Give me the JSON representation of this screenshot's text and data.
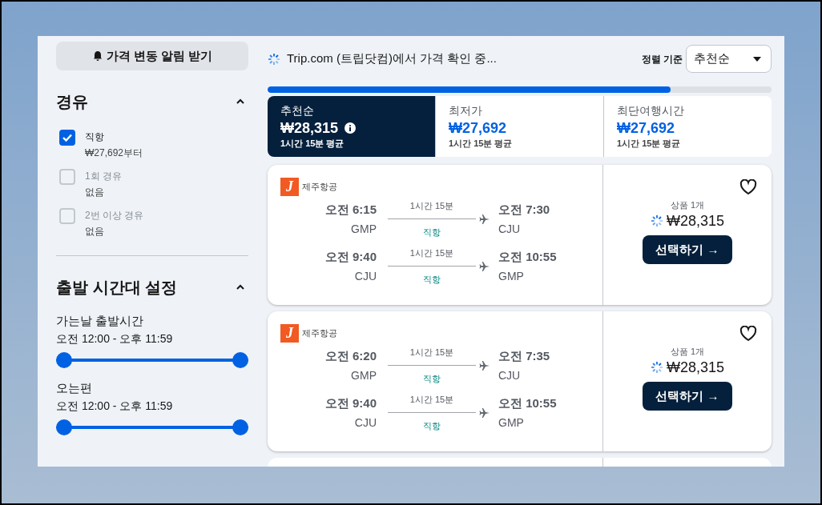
{
  "alert_button": {
    "label": "가격 변동 알림 받기"
  },
  "stops_filter": {
    "title": "경유",
    "expanded": true,
    "options": [
      {
        "label": "직항",
        "note": "₩27,692부터",
        "checked": true,
        "disabled": false
      },
      {
        "label": "1회 경유",
        "note": "없음",
        "checked": false,
        "disabled": true
      },
      {
        "label": "2번 이상 경유",
        "note": "없음",
        "checked": false,
        "disabled": true
      }
    ]
  },
  "time_filter": {
    "title": "출발 시간대 설정",
    "expanded": true,
    "ranges": [
      {
        "label": "가는날 출발시간",
        "value": "오전 12:00 - 오후 11:59",
        "level": 1
      },
      {
        "label": "오는편",
        "value": "오전 12:00 - 오후 11:59",
        "level": 1
      }
    ]
  },
  "status": {
    "text": "Trip.com (트립닷컴)에서 가격 확인 중..."
  },
  "sort": {
    "label": "정렬 기준",
    "value": "추천순"
  },
  "progress": {
    "level": 0.8
  },
  "sort_tabs": [
    {
      "title": "추천순",
      "price": "₩28,315",
      "note": "1시간 15분 평균",
      "selected": true,
      "info": true
    },
    {
      "title": "최저가",
      "price": "₩27,692",
      "note": "1시간 15분 평균",
      "selected": false,
      "info": false
    },
    {
      "title": "최단여행시간",
      "price": "₩27,692",
      "note": "1시간 15분 평균",
      "selected": false,
      "info": false
    }
  ],
  "results": [
    {
      "airline": "제주항공",
      "logo": "J",
      "legs": [
        {
          "dep_time": "오전 6:15",
          "dep_code": "GMP",
          "duration": "1시간 15분",
          "stops": "직항",
          "arr_time": "오전 7:30",
          "arr_code": "CJU"
        },
        {
          "dep_time": "오전 9:40",
          "dep_code": "CJU",
          "duration": "1시간 15분",
          "stops": "직항",
          "arr_time": "오전 10:55",
          "arr_code": "GMP"
        }
      ],
      "offers": "상품 1개",
      "price": "₩28,315",
      "button": "선택하기 →",
      "favorite": false
    },
    {
      "airline": "제주항공",
      "logo": "J",
      "legs": [
        {
          "dep_time": "오전 6:20",
          "dep_code": "GMP",
          "duration": "1시간 15분",
          "stops": "직항",
          "arr_time": "오전 7:35",
          "arr_code": "CJU"
        },
        {
          "dep_time": "오전 9:40",
          "dep_code": "CJU",
          "duration": "1시간 15분",
          "stops": "직항",
          "arr_time": "오전 10:55",
          "arr_code": "GMP"
        }
      ],
      "offers": "상품 1개",
      "price": "₩28,315",
      "button": "선택하기 →",
      "favorite": false
    }
  ]
}
